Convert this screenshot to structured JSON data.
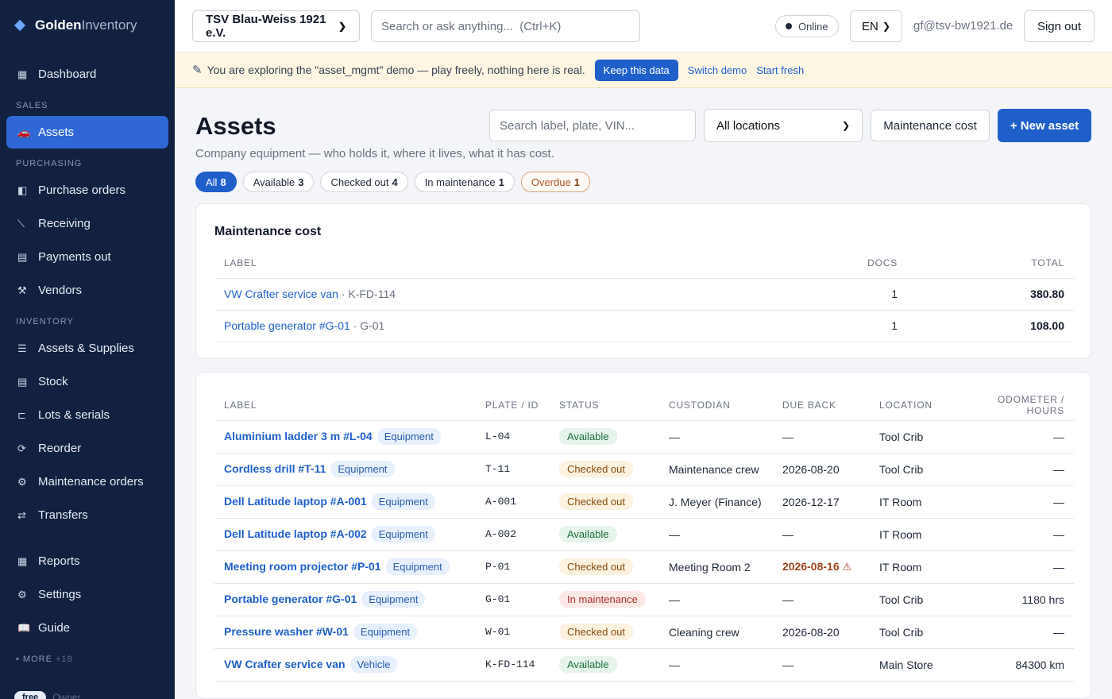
{
  "brand": {
    "strong": "Golden",
    "light": "Inventory"
  },
  "sidebar": {
    "dashboard": "Dashboard",
    "sections": {
      "sales": "SALES",
      "purchasing": "PURCHASING",
      "inventory": "INVENTORY"
    },
    "items": [
      {
        "label": "Assets",
        "icon": "car-icon",
        "glyph": "🚗"
      },
      {
        "label": "Purchase orders",
        "icon": "document-icon",
        "glyph": "◧"
      },
      {
        "label": "Receiving",
        "icon": "truck-icon",
        "glyph": "⟍"
      },
      {
        "label": "Payments out",
        "icon": "payment-icon",
        "glyph": "▤"
      },
      {
        "label": "Vendors",
        "icon": "tools-icon",
        "glyph": "⚒"
      },
      {
        "label": "Assets & Supplies",
        "icon": "list-icon",
        "glyph": "☰"
      },
      {
        "label": "Stock",
        "icon": "stock-icon",
        "glyph": "▤"
      },
      {
        "label": "Lots & serials",
        "icon": "tag-icon",
        "glyph": "⊏"
      },
      {
        "label": "Reorder",
        "icon": "refresh-icon",
        "glyph": "⟳"
      },
      {
        "label": "Maintenance orders",
        "icon": "gear-icon",
        "glyph": "⚙"
      },
      {
        "label": "Transfers",
        "icon": "arrows-icon",
        "glyph": "⇄"
      },
      {
        "label": "Reports",
        "icon": "grid-icon",
        "glyph": "▦"
      },
      {
        "label": "Settings",
        "icon": "gear-icon",
        "glyph": "⚙"
      },
      {
        "label": "Guide",
        "icon": "book-icon",
        "glyph": "📖"
      }
    ],
    "more_label": "MORE",
    "more_count": "+18",
    "plan_badge": "free",
    "plan_role": "Owner"
  },
  "topbar": {
    "org": "TSV Blau-Weiss 1921 e.V.",
    "search_placeholder": "Search or ask anything...  (Ctrl+K)",
    "online": "Online",
    "lang": "EN",
    "email": "gf@tsv-bw1921.de",
    "signout": "Sign out"
  },
  "banner": {
    "text": "You are exploring the \"asset_mgmt\" demo — play freely, nothing here is real.",
    "keep": "Keep this data",
    "switch": "Switch demo",
    "fresh": "Start fresh"
  },
  "page": {
    "title": "Assets",
    "subtitle": "Company equipment — who holds it, where it lives, what it has cost.",
    "search_placeholder": "Search label, plate, VIN...",
    "location": "All locations",
    "maint_button": "Maintenance cost",
    "new_button": "+ New asset"
  },
  "chips": [
    {
      "label": "All",
      "count": "8"
    },
    {
      "label": "Available",
      "count": "3"
    },
    {
      "label": "Checked out",
      "count": "4"
    },
    {
      "label": "In maintenance",
      "count": "1"
    },
    {
      "label": "Overdue",
      "count": "1"
    }
  ],
  "maint_card": {
    "title": "Maintenance cost",
    "headers": {
      "label": "LABEL",
      "docs": "DOCS",
      "total": "TOTAL"
    },
    "rows": [
      {
        "name": "VW Crafter service van",
        "id": " · K-FD-114",
        "docs": "1",
        "total": "380.80"
      },
      {
        "name": "Portable generator #G-01",
        "id": " · G-01",
        "docs": "1",
        "total": "108.00"
      }
    ]
  },
  "asset_table": {
    "headers": {
      "label": "LABEL",
      "plate": "PLATE / ID",
      "status": "STATUS",
      "custodian": "CUSTODIAN",
      "due": "DUE BACK",
      "location": "LOCATION",
      "odometer": "ODOMETER / HOURS"
    },
    "rows": [
      {
        "name": "Aluminium ladder 3 m #L-04",
        "type": "Equipment",
        "plate": "L-04",
        "status": "Available",
        "custodian": "—",
        "due": "—",
        "location": "Tool Crib",
        "odometer": "—"
      },
      {
        "name": "Cordless drill #T-11",
        "type": "Equipment",
        "plate": "T-11",
        "status": "Checked out",
        "custodian": "Maintenance crew",
        "due": "2026-08-20",
        "location": "Tool Crib",
        "odometer": "—"
      },
      {
        "name": "Dell Latitude laptop #A-001",
        "type": "Equipment",
        "plate": "A-001",
        "status": "Checked out",
        "custodian": "J. Meyer (Finance)",
        "due": "2026-12-17",
        "location": "IT Room",
        "odometer": "—"
      },
      {
        "name": "Dell Latitude laptop #A-002",
        "type": "Equipment",
        "plate": "A-002",
        "status": "Available",
        "custodian": "—",
        "due": "—",
        "location": "IT Room",
        "odometer": "—"
      },
      {
        "name": "Meeting room projector #P-01",
        "type": "Equipment",
        "plate": "P-01",
        "status": "Checked out",
        "custodian": "Meeting Room 2",
        "due": "2026-08-16",
        "location": "IT Room",
        "odometer": "—"
      },
      {
        "name": "Portable generator #G-01",
        "type": "Equipment",
        "plate": "G-01",
        "status": "In maintenance",
        "custodian": "—",
        "due": "—",
        "location": "Tool Crib",
        "odometer": "1180 hrs"
      },
      {
        "name": "Pressure washer #W-01",
        "type": "Equipment",
        "plate": "W-01",
        "status": "Checked out",
        "custodian": "Cleaning crew",
        "due": "2026-08-20",
        "location": "Tool Crib",
        "odometer": "—"
      },
      {
        "name": "VW Crafter service van",
        "type": "Vehicle",
        "plate": "K-FD-114",
        "status": "Available",
        "custodian": "—",
        "due": "—",
        "location": "Main Store",
        "odometer": "84300 km"
      }
    ]
  }
}
